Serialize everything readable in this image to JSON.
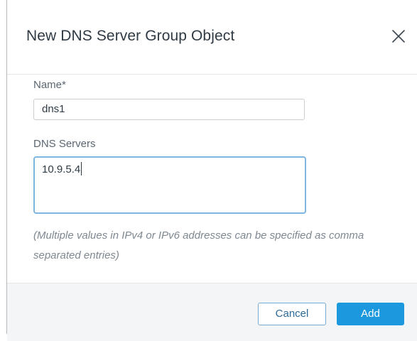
{
  "dialog": {
    "title": "New DNS Server Group Object"
  },
  "form": {
    "name_label": "Name*",
    "name_value": "dns1",
    "dns_label": "DNS Servers",
    "dns_value": "10.9.5.4",
    "hint": "(Multiple values in IPv4 or IPv6 addresses can be specified as comma separated entries)"
  },
  "footer": {
    "cancel_label": "Cancel",
    "add_label": "Add"
  },
  "icons": {
    "close": "close-icon"
  },
  "colors": {
    "primary": "#1b98de",
    "focus_border": "#7eb6df",
    "title_text": "#2f3a44",
    "hint_text": "#7f8891",
    "footer_bg": "#f4f5f7"
  }
}
